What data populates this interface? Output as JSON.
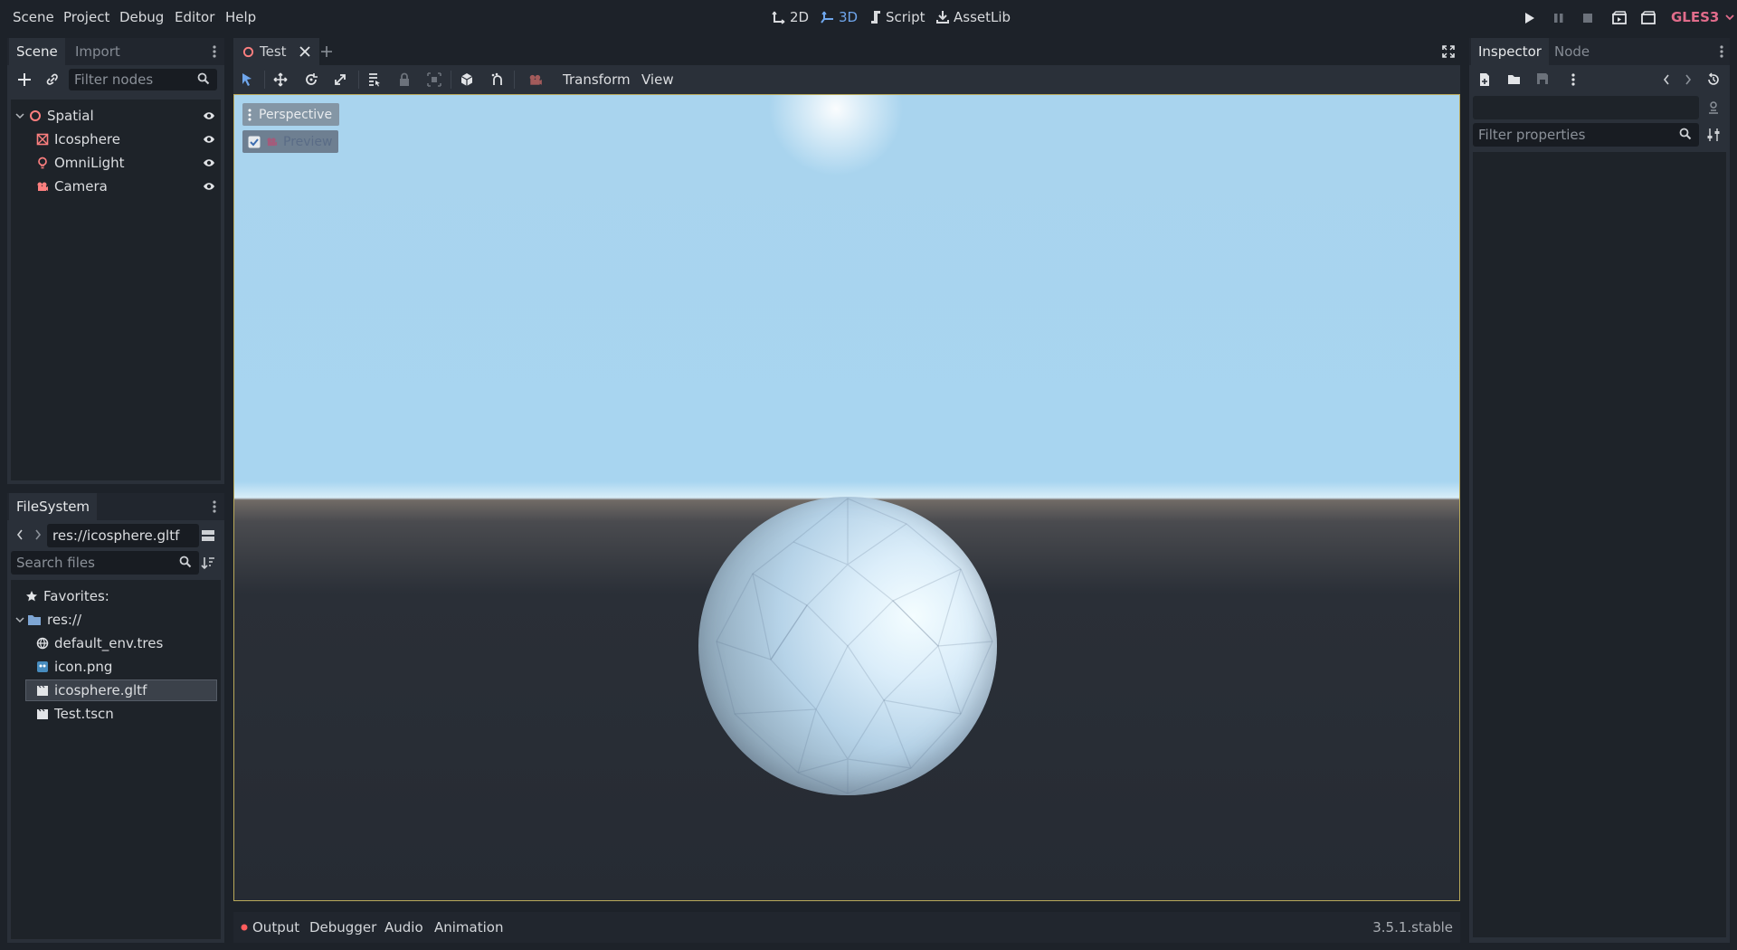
{
  "menubar": {
    "items": [
      "Scene",
      "Project",
      "Debug",
      "Editor",
      "Help"
    ],
    "workspaces": [
      {
        "label": "2D",
        "active": false
      },
      {
        "label": "3D",
        "active": true
      },
      {
        "label": "Script",
        "active": false
      },
      {
        "label": "AssetLib",
        "active": false
      }
    ],
    "renderer": "GLES3",
    "colors": {
      "accent": "#6fa6ec",
      "renderer": "#e16c8b"
    }
  },
  "scene_dock": {
    "tabs": [
      "Scene",
      "Import"
    ],
    "filter_placeholder": "Filter nodes",
    "nodes": [
      {
        "label": "Spatial",
        "icon": "spatial-node-icon"
      },
      {
        "label": "Icosphere",
        "icon": "mesh-instance-icon"
      },
      {
        "label": "OmniLight",
        "icon": "omni-light-icon"
      },
      {
        "label": "Camera",
        "icon": "camera-icon"
      }
    ]
  },
  "filesystem_dock": {
    "title": "FileSystem",
    "path": "res://icosphere.gltf",
    "search_placeholder": "Search files",
    "favorites_label": "Favorites:",
    "root_label": "res://",
    "files": [
      {
        "label": "default_env.tres",
        "icon": "environment-icon",
        "selected": false
      },
      {
        "label": "icon.png",
        "icon": "image-icon",
        "selected": false
      },
      {
        "label": "icosphere.gltf",
        "icon": "scene-file-icon",
        "selected": true
      },
      {
        "label": "Test.tscn",
        "icon": "scene-file-icon",
        "selected": false
      }
    ]
  },
  "editor_tabs": {
    "tabs": [
      {
        "label": "Test"
      }
    ]
  },
  "viewport_toolbar": {
    "transform_label": "Transform",
    "view_label": "View"
  },
  "viewport": {
    "perspective_label": "Perspective",
    "preview_label": "Preview"
  },
  "inspector": {
    "tabs": [
      "Inspector",
      "Node"
    ],
    "filter_placeholder": "Filter properties"
  },
  "bottom_panel": {
    "tabs": [
      "Output",
      "Debugger",
      "Audio",
      "Animation"
    ],
    "version": "3.5.1.stable"
  }
}
